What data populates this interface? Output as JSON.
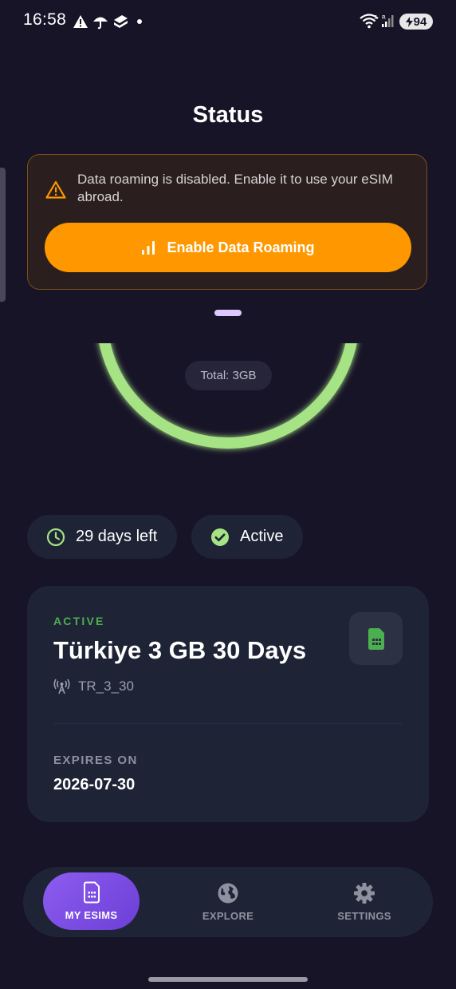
{
  "status_bar": {
    "time": "16:58",
    "battery": "94"
  },
  "page": {
    "title": "Status"
  },
  "roaming_warning": {
    "message": "Data roaming is disabled. Enable it to use your eSIM abroad.",
    "button_label": "Enable Data Roaming"
  },
  "usage": {
    "total_label": "Total: 3GB"
  },
  "chips": {
    "days_left": "29 days left",
    "status": "Active"
  },
  "esim": {
    "status_label": "ACTIVE",
    "name": "Türkiye 3 GB 30 Days",
    "code": "TR_3_30",
    "expires_label": "EXPIRES ON",
    "expires_value": "2026-07-30"
  },
  "nav": {
    "items": [
      {
        "label": "MY ESIMS",
        "icon": "sim-card-icon",
        "active": true
      },
      {
        "label": "EXPLORE",
        "icon": "globe-icon",
        "active": false
      },
      {
        "label": "SETTINGS",
        "icon": "gear-icon",
        "active": false
      }
    ]
  },
  "colors": {
    "background": "#171427",
    "accent_orange": "#ff9800",
    "ring_green": "#a6e384",
    "active_green": "#4caf50",
    "nav_active_purple": "#7c4ce3"
  }
}
